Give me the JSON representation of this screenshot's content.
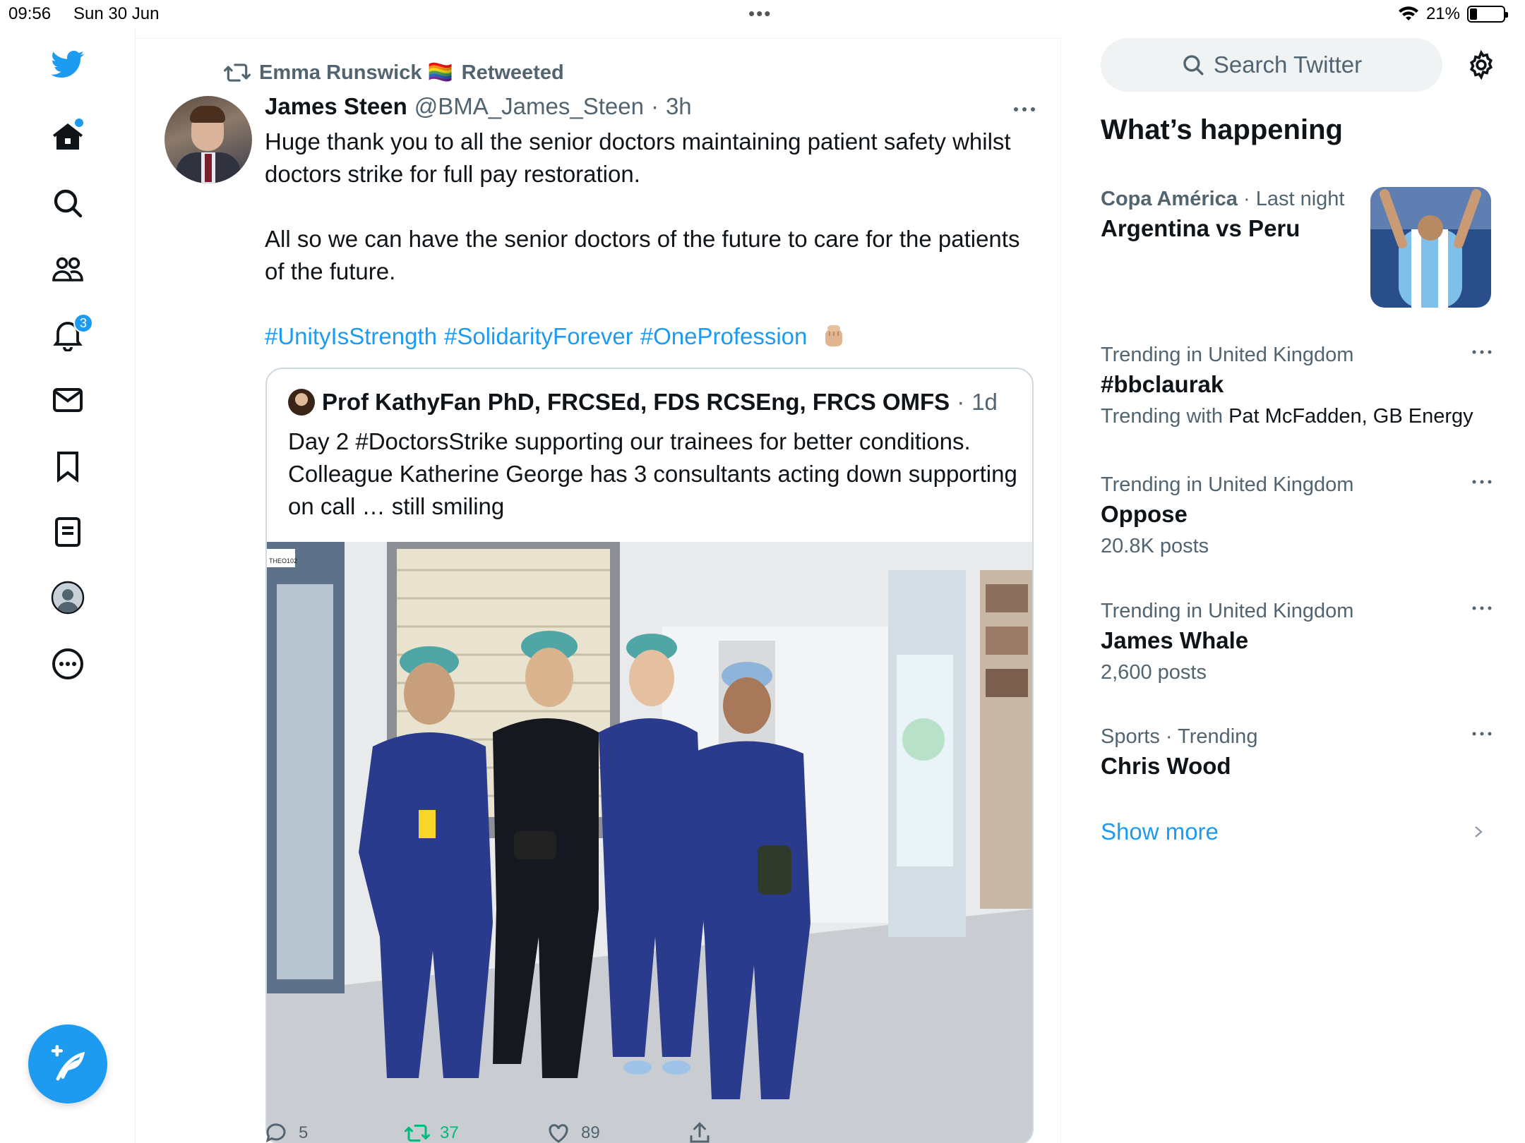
{
  "status_bar": {
    "time": "09:56",
    "date": "Sun 30 Jun",
    "battery": "21%",
    "battery_level": 0.21
  },
  "nav": {
    "items": [
      {
        "icon": "twitter-logo-icon"
      },
      {
        "icon": "home-icon",
        "has_dot": true
      },
      {
        "icon": "search-icon"
      },
      {
        "icon": "communities-icon"
      },
      {
        "icon": "notifications-bell-icon",
        "badge": "3"
      },
      {
        "icon": "messages-envelope-icon"
      },
      {
        "icon": "bookmarks-icon"
      },
      {
        "icon": "lists-icon"
      },
      {
        "icon": "profile-avatar-icon"
      },
      {
        "icon": "more-circle-icon"
      }
    ],
    "compose_icon": "compose-quill-icon"
  },
  "tweet": {
    "retweeted_by": "Emma Runswick 🏳️‍🌈",
    "retweeted_label": "Retweeted",
    "author_name": "James Steen",
    "author_handle": "@BMA_James_Steen",
    "separator": "·",
    "time": "3h",
    "text_p1": "Huge thank you to all the senior doctors maintaining patient safety whilst doctors strike for full pay restoration.",
    "text_p2": "All so we can have the senior doctors of the future to care for the patients of the future.",
    "hashtags": [
      "#UnityIsStrength",
      "#SolidarityForever",
      "#OneProfession"
    ],
    "emoji": "raised-fist-emoji",
    "quote": {
      "author": "Prof KathyFan PhD, FRCSEd, FDS RCSEng, FRCS OMFS",
      "separator": "·",
      "time": "1d",
      "text": "Day 2 #DoctorsStrike supporting our trainees for better conditions. Colleague Katherine George has 3 consultants acting down supporting on call … still smiling",
      "photo_sign": "THEO102"
    },
    "actions": {
      "replies": "5",
      "retweets": "37",
      "likes": "89"
    }
  },
  "sidebar": {
    "search_placeholder": "Search Twitter",
    "whats_happening": "What’s happening",
    "trends": [
      {
        "category": "Copa América",
        "separator": "·",
        "when": "Last night",
        "title": "Argentina vs Peru"
      },
      {
        "meta": "Trending in United Kingdom",
        "title": "#bbclaurak",
        "sub_prefix": "Trending with",
        "sub_value": "Pat McFadden, GB Energy"
      },
      {
        "meta": "Trending in United Kingdom",
        "title": "Oppose",
        "sub": "20.8K posts"
      },
      {
        "meta": "Trending in United Kingdom",
        "title": "James Whale",
        "sub": "2,600 posts"
      },
      {
        "meta": "Sports · Trending",
        "title": "Chris Wood"
      }
    ],
    "show_more": "Show more"
  },
  "colors": {
    "accent": "#1d9bf0",
    "retweet_green": "#00ba7c",
    "secondary_text": "#536471",
    "primary_text": "#0f1419"
  }
}
